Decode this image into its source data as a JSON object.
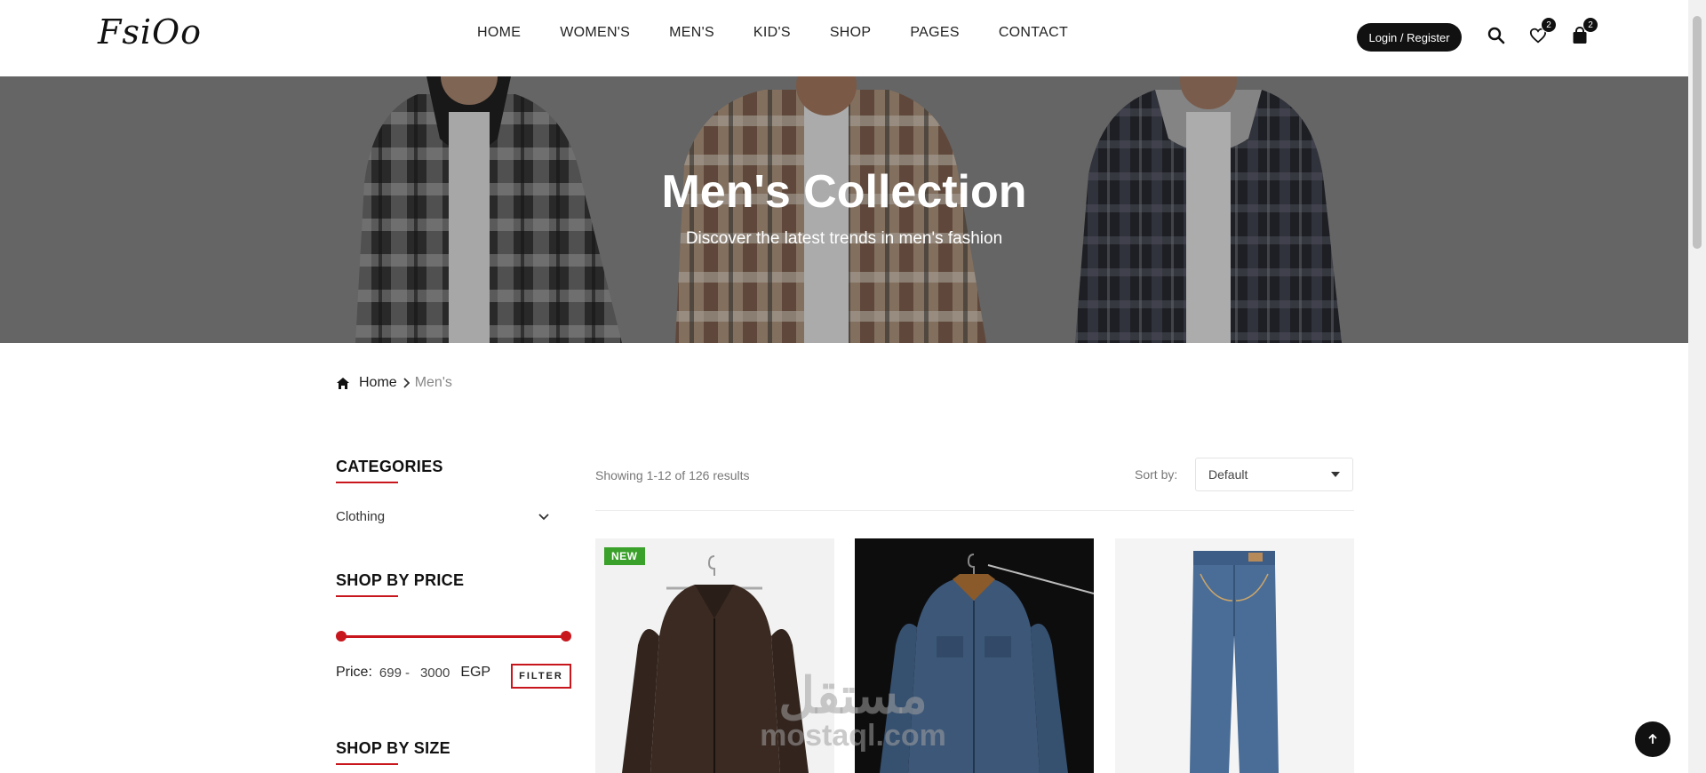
{
  "header": {
    "logo": "FsiOo",
    "nav": [
      "HOME",
      "WOMEN'S",
      "MEN'S",
      "KID'S",
      "SHOP",
      "PAGES",
      "CONTACT"
    ],
    "login_label": "Login / Register",
    "wishlist_count": "2",
    "cart_count": "2",
    "icons": [
      "search-icon",
      "heart-icon",
      "bag-icon"
    ]
  },
  "hero": {
    "title": "Men's Collection",
    "subtitle": "Discover the latest trends in men's fashion"
  },
  "breadcrumb": {
    "home": "Home",
    "current": "Men's"
  },
  "sidebar": {
    "categories_title": "CATEGORIES",
    "category_item": "Clothing",
    "price_title": "SHOP BY PRICE",
    "price_label": "Price:",
    "price_min": "699",
    "price_sep": "-",
    "price_max": "3000",
    "currency": "EGP",
    "filter_label": "FILTER",
    "size_title": "SHOP BY SIZE"
  },
  "toolbar": {
    "results_text": "Showing 1-12 of 126 results",
    "sort_label": "Sort by:",
    "sort_value": "Default"
  },
  "products": [
    {
      "badge": "NEW",
      "item": "leather jacket"
    },
    {
      "badge": "",
      "item": "denim jacket"
    },
    {
      "badge": "",
      "item": "jeans"
    }
  ],
  "watermark": {
    "arabic": "مستقل",
    "latin": "mostaql.com"
  },
  "colors": {
    "accent": "#c8161d",
    "dark": "#111111",
    "new_badge": "#3aa12a"
  }
}
